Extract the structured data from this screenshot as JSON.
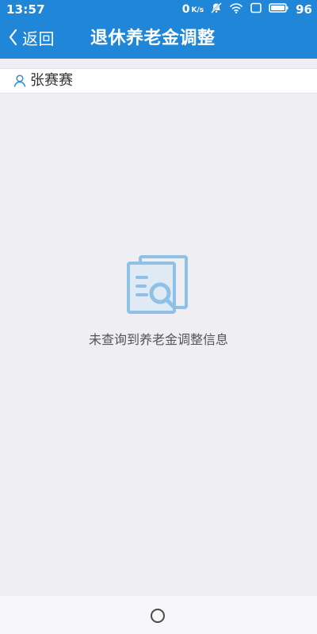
{
  "status_bar": {
    "time": "13:57",
    "network_speed": "0",
    "network_unit": "K/s",
    "battery_level": "96",
    "icons": [
      "silent-icon",
      "wifi-icon",
      "screen-icon",
      "battery-icon"
    ]
  },
  "app_bar": {
    "back_label": "返回",
    "title": "退休养老金调整"
  },
  "user": {
    "name": "张赛赛",
    "icon": "user-icon"
  },
  "empty_state": {
    "icon": "document-search-icon",
    "message": "未查询到养老金调整信息"
  },
  "bottom_nav": {
    "home_icon": "home-circle-icon"
  },
  "colors": {
    "primary": "#1f86d8",
    "background": "#efeef2",
    "text_dark": "#333333",
    "icon_accent": "#8fc1e6"
  }
}
